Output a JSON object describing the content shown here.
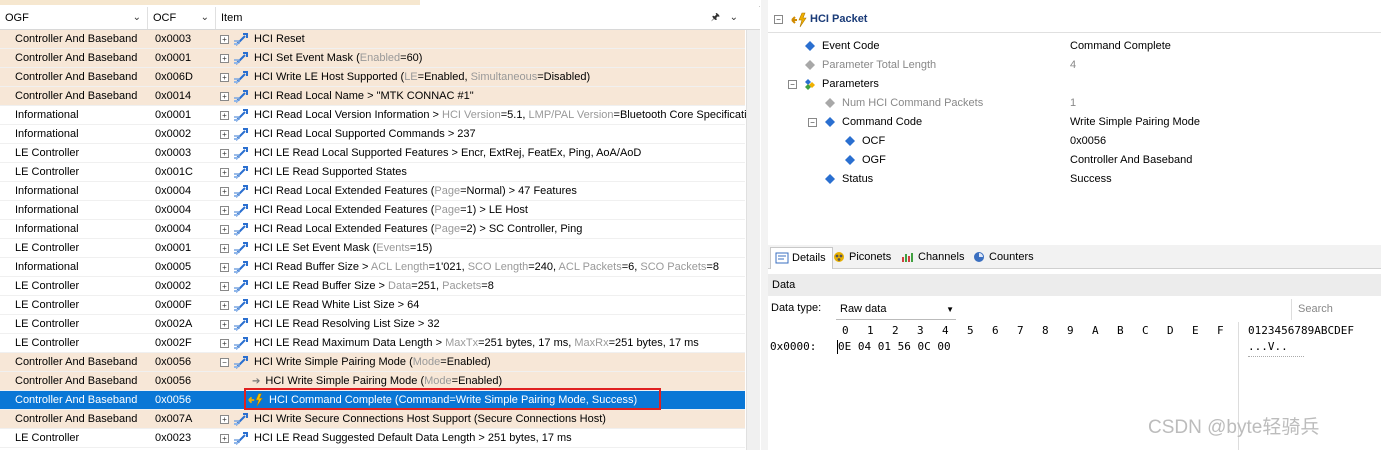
{
  "columns": {
    "ogf": "OGF",
    "ocf": "OCF",
    "item": "Item"
  },
  "rows": [
    {
      "ogf": "Controller And Baseband",
      "ocf": "0x0003",
      "type": "ctrl",
      "kind": "cmd",
      "parts": [
        [
          "HCI Reset",
          ""
        ]
      ]
    },
    {
      "ogf": "Controller And Baseband",
      "ocf": "0x0001",
      "type": "ctrl",
      "kind": "cmd",
      "parts": [
        [
          "HCI Set Event Mask (",
          ""
        ],
        [
          "Enabled",
          "g"
        ],
        [
          "=60)",
          ""
        ]
      ]
    },
    {
      "ogf": "Controller And Baseband",
      "ocf": "0x006D",
      "type": "ctrl",
      "kind": "cmd",
      "parts": [
        [
          "HCI Write LE Host Supported (",
          ""
        ],
        [
          "LE",
          "g"
        ],
        [
          "=Enabled, ",
          ""
        ],
        [
          "Simultaneous",
          "g"
        ],
        [
          "=Disabled)",
          ""
        ]
      ]
    },
    {
      "ogf": "Controller And Baseband",
      "ocf": "0x0014",
      "type": "ctrl",
      "kind": "cmd",
      "parts": [
        [
          "HCI Read Local Name > \"MTK CONNAC #1\"",
          ""
        ]
      ]
    },
    {
      "ogf": "Informational",
      "ocf": "0x0001",
      "type": "",
      "kind": "cmd",
      "parts": [
        [
          "HCI Read Local Version Information > ",
          ""
        ],
        [
          "HCI Version",
          "g"
        ],
        [
          "=5.1, ",
          ""
        ],
        [
          "LMP/PAL Version",
          "g"
        ],
        [
          "=Bluetooth Core Specification",
          ""
        ]
      ]
    },
    {
      "ogf": "Informational",
      "ocf": "0x0002",
      "type": "",
      "kind": "cmd",
      "parts": [
        [
          "HCI Read Local Supported Commands > 237",
          ""
        ]
      ]
    },
    {
      "ogf": "LE Controller",
      "ocf": "0x0003",
      "type": "",
      "kind": "cmd",
      "parts": [
        [
          "HCI LE Read Local Supported Features > Encr, ExtRej, FeatEx, Ping, AoA/AoD",
          ""
        ]
      ]
    },
    {
      "ogf": "LE Controller",
      "ocf": "0x001C",
      "type": "",
      "kind": "cmd",
      "parts": [
        [
          "HCI LE Read Supported States",
          ""
        ]
      ]
    },
    {
      "ogf": "Informational",
      "ocf": "0x0004",
      "type": "",
      "kind": "cmd",
      "parts": [
        [
          "HCI Read Local Extended Features (",
          ""
        ],
        [
          "Page",
          "g"
        ],
        [
          "=Normal) > 47 Features",
          ""
        ]
      ]
    },
    {
      "ogf": "Informational",
      "ocf": "0x0004",
      "type": "",
      "kind": "cmd",
      "parts": [
        [
          "HCI Read Local Extended Features (",
          ""
        ],
        [
          "Page",
          "g"
        ],
        [
          "=1) > LE Host",
          ""
        ]
      ]
    },
    {
      "ogf": "Informational",
      "ocf": "0x0004",
      "type": "",
      "kind": "cmd",
      "parts": [
        [
          "HCI Read Local Extended Features (",
          ""
        ],
        [
          "Page",
          "g"
        ],
        [
          "=2) > SC Controller, Ping",
          ""
        ]
      ]
    },
    {
      "ogf": "LE Controller",
      "ocf": "0x0001",
      "type": "",
      "kind": "cmd",
      "parts": [
        [
          "HCI LE Set Event Mask (",
          ""
        ],
        [
          "Events",
          "g"
        ],
        [
          "=15)",
          ""
        ]
      ]
    },
    {
      "ogf": "Informational",
      "ocf": "0x0005",
      "type": "",
      "kind": "cmd",
      "parts": [
        [
          "HCI Read Buffer Size > ",
          ""
        ],
        [
          "ACL Length",
          "g"
        ],
        [
          "=1'021, ",
          ""
        ],
        [
          "SCO Length",
          "g"
        ],
        [
          "=240, ",
          ""
        ],
        [
          "ACL Packets",
          "g"
        ],
        [
          "=6, ",
          ""
        ],
        [
          "SCO Packets",
          "g"
        ],
        [
          "=8",
          ""
        ]
      ]
    },
    {
      "ogf": "LE Controller",
      "ocf": "0x0002",
      "type": "",
      "kind": "cmd",
      "parts": [
        [
          "HCI LE Read Buffer Size > ",
          ""
        ],
        [
          "Data",
          "g"
        ],
        [
          "=251, ",
          ""
        ],
        [
          "Packets",
          "g"
        ],
        [
          "=8",
          ""
        ]
      ]
    },
    {
      "ogf": "LE Controller",
      "ocf": "0x000F",
      "type": "",
      "kind": "cmd",
      "parts": [
        [
          "HCI LE Read White List Size > 64",
          ""
        ]
      ]
    },
    {
      "ogf": "LE Controller",
      "ocf": "0x002A",
      "type": "",
      "kind": "cmd",
      "parts": [
        [
          "HCI LE Read Resolving List Size > 32",
          ""
        ]
      ]
    },
    {
      "ogf": "LE Controller",
      "ocf": "0x002F",
      "type": "",
      "kind": "cmd",
      "parts": [
        [
          "HCI LE Read Maximum Data Length > ",
          ""
        ],
        [
          "MaxTx",
          "g"
        ],
        [
          "=251 bytes, 17 ms, ",
          ""
        ],
        [
          "MaxRx",
          "g"
        ],
        [
          "=251 bytes, 17 ms",
          ""
        ]
      ]
    },
    {
      "ogf": "Controller And Baseband",
      "ocf": "0x0056",
      "type": "ctrl",
      "kind": "cmd-open",
      "parts": [
        [
          "HCI Write Simple Pairing Mode (",
          ""
        ],
        [
          "Mode",
          "g"
        ],
        [
          "=Enabled)",
          ""
        ]
      ]
    },
    {
      "ogf": "Controller And Baseband",
      "ocf": "0x0056",
      "type": "ctrl",
      "kind": "child-arrow",
      "parts": [
        [
          "HCI Write Simple Pairing Mode (",
          ""
        ],
        [
          "Mode",
          "g"
        ],
        [
          "=Enabled)",
          ""
        ]
      ]
    },
    {
      "ogf": "Controller And Baseband",
      "ocf": "0x0056",
      "type": "sel",
      "kind": "child-event",
      "parts": [
        [
          "HCI Command Complete (",
          ""
        ],
        [
          "Command=Write Simple Pairing Mode, Success)",
          ""
        ]
      ]
    },
    {
      "ogf": "Controller And Baseband",
      "ocf": "0x007A",
      "type": "ctrl",
      "kind": "cmd",
      "parts": [
        [
          "HCI Write Secure Connections Host Support (Secure Connections Host)",
          ""
        ]
      ]
    },
    {
      "ogf": "LE Controller",
      "ocf": "0x0023",
      "type": "",
      "kind": "cmd",
      "parts": [
        [
          "HCI LE Read Suggested Default Data Length > 251 bytes, 17 ms",
          ""
        ]
      ]
    }
  ],
  "packet": {
    "title": "HCI Packet",
    "fields": [
      {
        "label": "Event Code",
        "value": "Command Complete",
        "indent": 1,
        "expander": "",
        "icon": "blue",
        "dim": false
      },
      {
        "label": "Parameter Total Length",
        "value": "4",
        "indent": 1,
        "expander": "",
        "icon": "gray",
        "dim": true
      },
      {
        "label": "Parameters",
        "value": "",
        "indent": 1,
        "expander": "−",
        "icon": "multi",
        "dim": false
      },
      {
        "label": "Num HCI Command Packets",
        "value": "1",
        "indent": 2,
        "expander": "",
        "icon": "gray",
        "dim": true
      },
      {
        "label": "Command Code",
        "value": "Write Simple Pairing Mode",
        "indent": 2,
        "expander": "−",
        "icon": "blue",
        "dim": false
      },
      {
        "label": "OCF",
        "value": "0x0056",
        "indent": 3,
        "expander": "",
        "icon": "blue",
        "dim": false
      },
      {
        "label": "OGF",
        "value": "Controller And Baseband",
        "indent": 3,
        "expander": "",
        "icon": "blue",
        "dim": false
      },
      {
        "label": "Status",
        "value": "Success",
        "indent": 2,
        "expander": "",
        "icon": "blue",
        "dim": false
      }
    ]
  },
  "tabs": [
    {
      "label": "Details",
      "icon": "details-icon",
      "active": true
    },
    {
      "label": "Piconets",
      "icon": "piconets-icon",
      "active": false
    },
    {
      "label": "Channels",
      "icon": "channels-icon",
      "active": false
    },
    {
      "label": "Counters",
      "icon": "counters-icon",
      "active": false
    }
  ],
  "data": {
    "header": "Data",
    "type_label": "Data type:",
    "type_value": "Raw data",
    "search_placeholder": "Search",
    "hex_columns": [
      "0",
      "1",
      "2",
      "3",
      "4",
      "5",
      "6",
      "7",
      "8",
      "9",
      "A",
      "B",
      "C",
      "D",
      "E",
      "F"
    ],
    "ascii_header": "0123456789ABCDEF",
    "address": "0x0000:",
    "bytes": "0E 04 01 56 0C 00",
    "ascii": "...V.."
  },
  "watermark": "CSDN @byte轻骑兵",
  "colors": {
    "ctrl_row": "#f7e7d7",
    "selected_row": "#0a77d6",
    "highlight_box": "#e02020",
    "title_blue": "#1a3b78"
  }
}
